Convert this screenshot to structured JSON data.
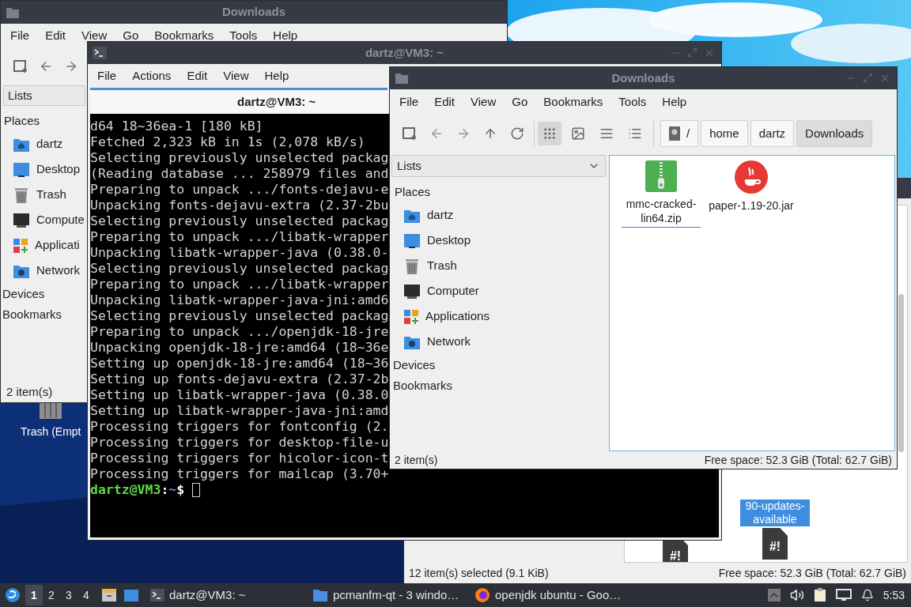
{
  "back_window": {
    "title": "Downloads",
    "menu": [
      "File",
      "Edit",
      "View",
      "Go",
      "Bookmarks",
      "Tools",
      "Help"
    ],
    "side_panel": "Lists",
    "places_header": "Places",
    "places": [
      {
        "label": "dartz",
        "kind": "home"
      },
      {
        "label": "Desktop",
        "kind": "desktop"
      },
      {
        "label": "Trash",
        "kind": "trash"
      },
      {
        "label": "Compute",
        "kind": "computer"
      },
      {
        "label": "Applicati",
        "kind": "applications"
      },
      {
        "label": "Network",
        "kind": "network"
      }
    ],
    "sections": [
      "Devices",
      "Bookmarks"
    ],
    "status": "2 item(s)"
  },
  "desktop_icons": [
    {
      "label": "Trash (Empt"
    }
  ],
  "rear_window": {
    "files": [
      {
        "name": "90-updates-available",
        "selected": true
      }
    ],
    "scripts": [
      {
        "badge": "#!"
      },
      {
        "badge": "#!"
      }
    ],
    "status": "12 item(s) selected (9.1 KiB)",
    "free_space": "Free space: 52.3 GiB (Total: 62.7 GiB)"
  },
  "terminal": {
    "title": "dartz@VM3: ~",
    "menu": [
      "File",
      "Actions",
      "Edit",
      "View",
      "Help"
    ],
    "tab_title": "dartz@VM3: ~",
    "lines": [
      "d64 18~36ea-1 [180 kB]",
      "Fetched 2,323 kB in 1s (2,078 kB/s)",
      "Selecting previously unselected packag",
      "(Reading database ... 258979 files and",
      "Preparing to unpack .../fonts-dejavu-e",
      "Unpacking fonts-dejavu-extra (2.37-2bu",
      "Selecting previously unselected packag",
      "Preparing to unpack .../libatk-wrapper",
      "Unpacking libatk-wrapper-java (0.38.0-",
      "Selecting previously unselected packag",
      "Preparing to unpack .../libatk-wrapper",
      "Unpacking libatk-wrapper-java-jni:amd6",
      "Selecting previously unselected packag",
      "Preparing to unpack .../openjdk-18-jre",
      "Unpacking openjdk-18-jre:amd64 (18~36e",
      "Setting up openjdk-18-jre:amd64 (18~36",
      "Setting up fonts-dejavu-extra (2.37-2b",
      "Setting up libatk-wrapper-java (0.38.0",
      "Setting up libatk-wrapper-java-jni:amd",
      "Processing triggers for fontconfig (2.",
      "Processing triggers for desktop-file-u",
      "Processing triggers for hicolor-icon-t",
      "Processing triggers for mailcap (3.70+"
    ],
    "prompt": {
      "user": "dartz@VM3",
      "sep": ":",
      "path": "~",
      "symbol": "$"
    }
  },
  "front_window": {
    "title": "Downloads",
    "menu": [
      "File",
      "Edit",
      "View",
      "Go",
      "Bookmarks",
      "Tools",
      "Help"
    ],
    "view_modes": [
      {
        "kind": "icons",
        "selected": true
      },
      {
        "kind": "thumbnails",
        "selected": false
      },
      {
        "kind": "compact",
        "selected": false
      },
      {
        "kind": "details",
        "selected": false
      }
    ],
    "breadcrumb": [
      {
        "label": "/",
        "kind": "root",
        "selected": false
      },
      {
        "label": "home",
        "kind": "folder",
        "selected": false
      },
      {
        "label": "dartz",
        "kind": "folder",
        "selected": false
      },
      {
        "label": "Downloads",
        "kind": "folder",
        "selected": true
      }
    ],
    "side_panel": "Lists",
    "places_header": "Places",
    "places": [
      {
        "label": "dartz",
        "kind": "home"
      },
      {
        "label": "Desktop",
        "kind": "desktop"
      },
      {
        "label": "Trash",
        "kind": "trash"
      },
      {
        "label": "Computer",
        "kind": "computer"
      },
      {
        "label": "Applications",
        "kind": "applications"
      },
      {
        "label": "Network",
        "kind": "network"
      }
    ],
    "sections": [
      "Devices",
      "Bookmarks"
    ],
    "files": [
      {
        "name": "mmc-cracked-lin64.zip",
        "kind": "archive",
        "focused": true
      },
      {
        "name": "paper-1.19-20.jar",
        "kind": "java",
        "focused": false
      }
    ],
    "status": "2 item(s)",
    "free_space": "Free space: 52.3 GiB (Total: 62.7 GiB)"
  },
  "taskbar": {
    "workspaces": [
      {
        "label": "1",
        "selected": true
      },
      {
        "label": "2",
        "selected": false
      },
      {
        "label": "3",
        "selected": false
      },
      {
        "label": "4",
        "selected": false
      }
    ],
    "tasks": [
      {
        "label": "dartz@VM3: ~",
        "kind": "terminal"
      },
      {
        "label": "pcmanfm-qt - 3 windo…",
        "kind": "folder"
      },
      {
        "label": "openjdk ubuntu - Goo…",
        "kind": "browser"
      }
    ],
    "clock": "5:53"
  }
}
